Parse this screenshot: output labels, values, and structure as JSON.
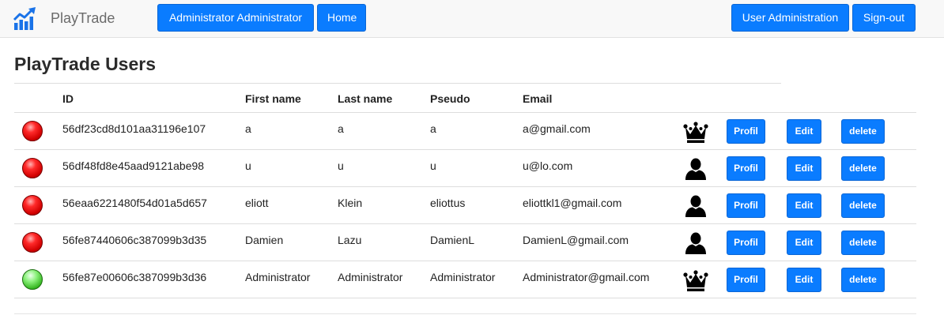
{
  "brand": {
    "name": "PlayTrade",
    "logo_icon": "bar-chart-trend-icon"
  },
  "nav": {
    "user_label": "Administrator Administrator",
    "home_label": "Home",
    "user_admin_label": "User Administration",
    "signout_label": "Sign-out"
  },
  "page": {
    "title": "PlayTrade Users"
  },
  "table": {
    "headers": {
      "id": "ID",
      "first_name": "First name",
      "last_name": "Last name",
      "pseudo": "Pseudo",
      "email": "Email"
    },
    "actions": {
      "profil": "Profil",
      "edit": "Edit",
      "delete": "delete"
    },
    "rows": [
      {
        "status": "red",
        "id": "56df23cd8d101aa31196e107",
        "first_name": "a",
        "last_name": "a",
        "pseudo": "a",
        "email": "a@gmail.com",
        "role_icon": "crown-icon"
      },
      {
        "status": "red",
        "id": "56df48fd8e45aad9121abe98",
        "first_name": "u",
        "last_name": "u",
        "pseudo": "u",
        "email": "u@lo.com",
        "role_icon": "user-icon"
      },
      {
        "status": "red",
        "id": "56eaa6221480f54d01a5d657",
        "first_name": "eliott",
        "last_name": "Klein",
        "pseudo": "eliottus",
        "email": "eliottkl1@gmail.com",
        "role_icon": "user-icon"
      },
      {
        "status": "red",
        "id": "56fe87440606c387099b3d35",
        "first_name": "Damien",
        "last_name": "Lazu",
        "pseudo": "DamienL",
        "email": "DamienL@gmail.com",
        "role_icon": "user-icon"
      },
      {
        "status": "green",
        "id": "56fe87e00606c387099b3d36",
        "first_name": "Administrator",
        "last_name": "Administrator",
        "pseudo": "Administrator",
        "email": "Administrator@gmail.com",
        "role_icon": "crown-icon"
      }
    ]
  },
  "colors": {
    "primary_button": "#0a7cff",
    "navbar_bg": "#f8f8f8",
    "status_offline": "#d10000",
    "status_online": "#34b51f",
    "logo": "#1a73e8"
  }
}
